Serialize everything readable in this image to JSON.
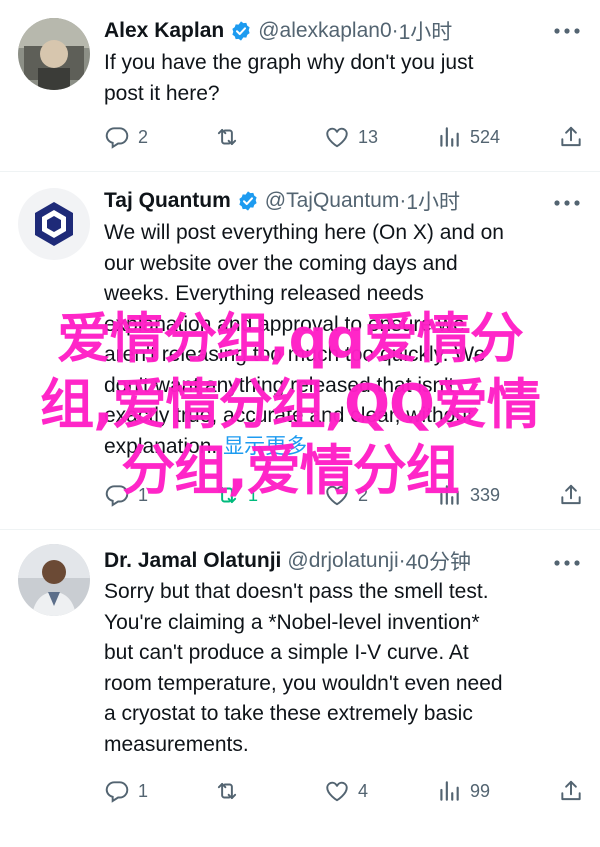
{
  "tweets": [
    {
      "name": "Alex Kaplan",
      "handle": "@alexkaplan0",
      "time": "1小时",
      "text": "If you have the graph why don't you just\npost it here?",
      "replies": "2",
      "retweets": "",
      "likes": "13",
      "views": "524"
    },
    {
      "name": "Taj Quantum",
      "handle": "@TajQuantum",
      "time": "1小时",
      "text": "We will post everything here (On X) and on\nour website over the coming days and\nweeks. Everything released needs\nexplanation and approval to ensure we\naren't releasing too much too quickly. We\ndon't want anything released that isn't\nexactly true, accurate and clear, without\nexplanation.",
      "show_more": "显示更多",
      "replies": "1",
      "retweets": "1",
      "likes": "2",
      "views": "339"
    },
    {
      "name": "Dr. Jamal Olatunji",
      "handle": "@drjolatunji",
      "time": "40分钟",
      "text": "Sorry but that doesn't pass the smell test.\nYou're claiming a *Nobel-level invention*\nbut can't produce a simple I-V curve. At\nroom temperature, you wouldn't even need\na cryostat to take these extremely basic\nmeasurements.",
      "replies": "1",
      "retweets": "",
      "likes": "4",
      "views": "99"
    }
  ],
  "separator": "·",
  "watermark": "爱情分组,qq爱情分组,爱情分组,QQ爱情分组,爱情分组",
  "colors": {
    "watermark": "#ff1fc7",
    "verified": "#1d9bf0",
    "retweet_active": "#00ba7c",
    "muted": "#536471"
  }
}
